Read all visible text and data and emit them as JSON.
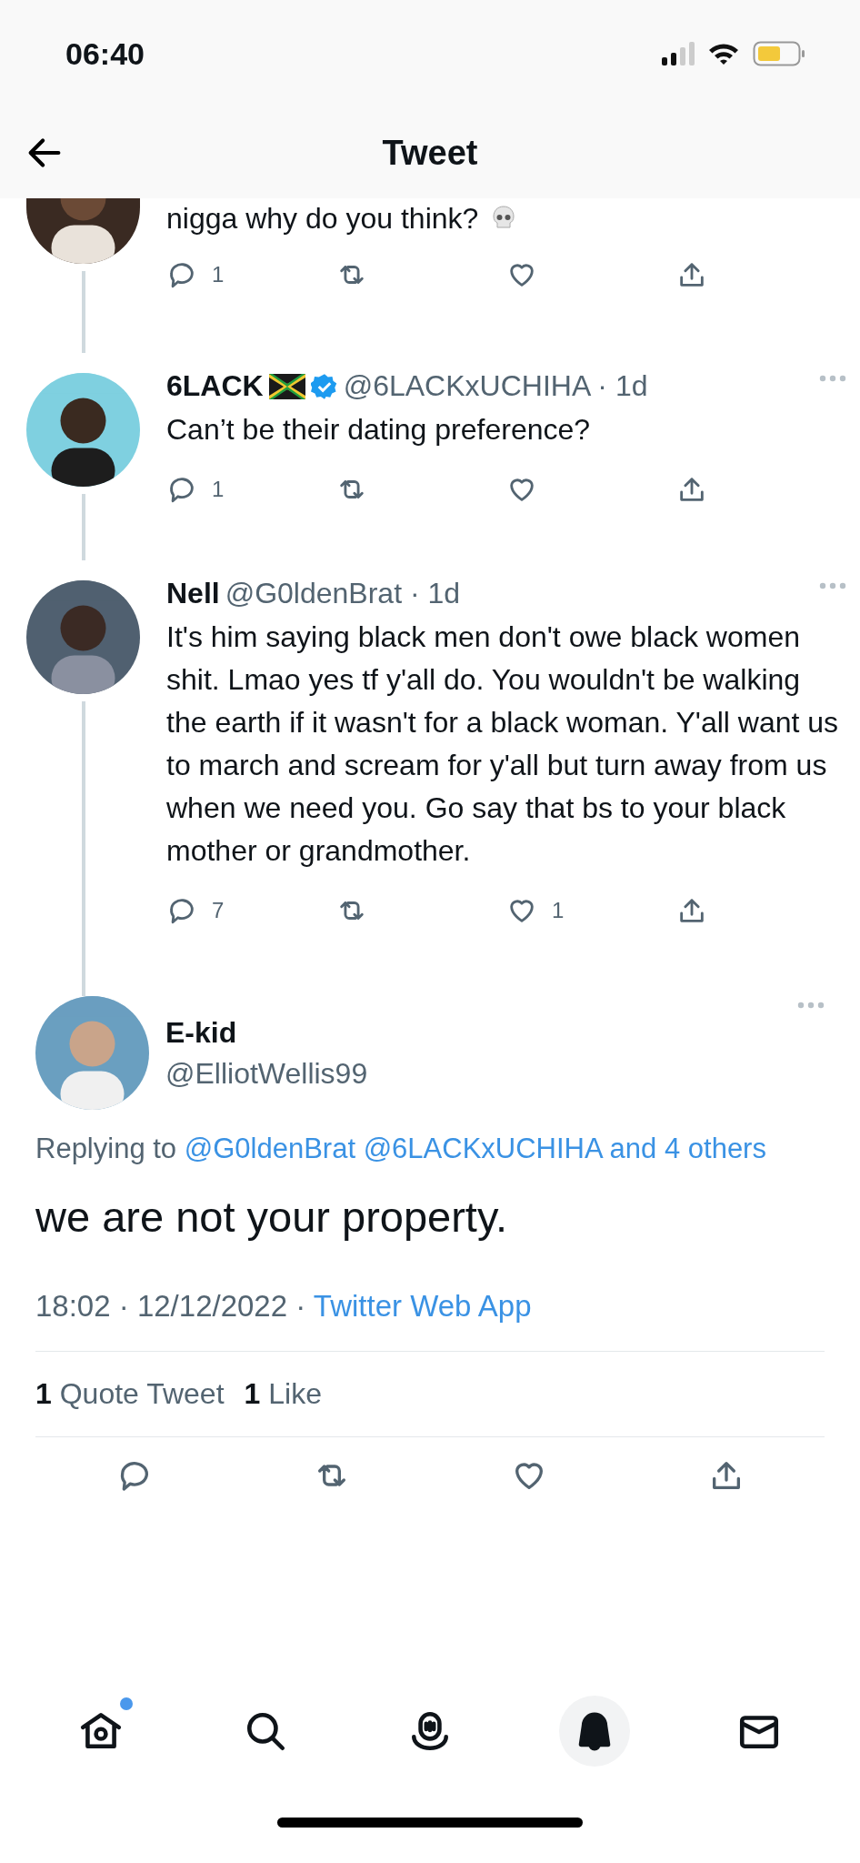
{
  "status_bar": {
    "time": "06:40"
  },
  "header": {
    "title": "Tweet"
  },
  "thread": [
    {
      "kind": "cut",
      "text": "nigga why do you think?",
      "actions": {
        "reply": "1"
      }
    },
    {
      "kind": "full",
      "name": "6LACK",
      "verified": true,
      "handle": "@6LACKxUCHIHA · 1d",
      "text": "Can’t be their dating preference?",
      "actions": {
        "reply": "1"
      }
    },
    {
      "kind": "full",
      "name": "Nell",
      "verified": false,
      "handle": "@G0ldenBrat · 1d",
      "text": "It's him saying black men don't owe black women shit. Lmao yes tf y'all do. You wouldn't be walking the earth if it wasn't for a black woman. Y'all want us to march and scream for y'all but turn away from us when we need you. Go say that bs to your black mother or grandmother.",
      "actions": {
        "reply": "7",
        "like": "1"
      }
    }
  ],
  "main_tweet": {
    "name": "E-kid",
    "handle": "@ElliotWellis99",
    "replying_prefix": "Replying to",
    "replying_to": [
      "@G0ldenBrat",
      "@6LACKxUCHIHA",
      "and 4 others"
    ],
    "text": "we are not your property.",
    "timestamp": "18:02 · 12/12/2022 ·",
    "source": "Twitter Web App",
    "stats": [
      {
        "count": "1",
        "label": "Quote Tweet"
      },
      {
        "count": "1",
        "label": "Like"
      }
    ]
  },
  "nav": [
    {
      "kind": "home",
      "selected": false,
      "has_badge": true
    },
    {
      "kind": "search",
      "selected": false,
      "has_badge": false
    },
    {
      "kind": "spaces",
      "selected": false,
      "has_badge": false
    },
    {
      "kind": "notifications",
      "selected": true,
      "has_badge": false
    },
    {
      "kind": "messages",
      "selected": false,
      "has_badge": false
    }
  ]
}
